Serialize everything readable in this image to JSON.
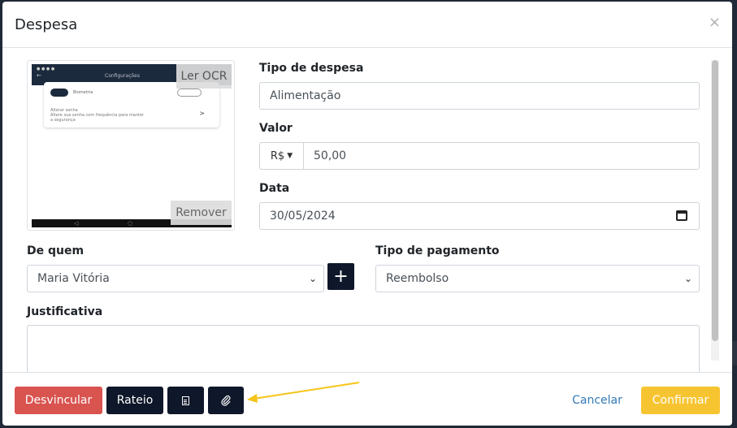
{
  "modal": {
    "title": "Despesa",
    "close_icon": "×"
  },
  "receipt": {
    "ocr_label": "Ler OCR",
    "remove_label": "Remover",
    "preview": {
      "screen_title": "Configurações",
      "row1_text": "Biometria",
      "row2_title": "Alterar senha",
      "row2_desc": "Altere sua senha com frequência para manter",
      "row2_desc2": "a segurança"
    }
  },
  "form": {
    "tipo_despesa": {
      "label": "Tipo de despesa",
      "value": "Alimentação"
    },
    "valor": {
      "label": "Valor",
      "currency": "R$",
      "value": "50,00"
    },
    "data": {
      "label": "Data",
      "value": "30/05/2024"
    },
    "de_quem": {
      "label": "De quem",
      "value": "Maria Vitória",
      "add_label": "+"
    },
    "tipo_pagamento": {
      "label": "Tipo de pagamento",
      "value": "Reembolso"
    },
    "justificativa": {
      "label": "Justificativa",
      "value": ""
    }
  },
  "footer": {
    "desvincular": "Desvincular",
    "rateio": "Rateio",
    "cancelar": "Cancelar",
    "confirmar": "Confirmar"
  },
  "icons": {
    "document": "document-icon",
    "paperclip": "paperclip-icon",
    "calendar": "calendar-icon",
    "plus": "plus-icon",
    "chevron": "chevron-down-icon"
  },
  "colors": {
    "danger": "#d9534f",
    "dark": "#0f172a",
    "warning": "#f7c431",
    "link": "#337ab7",
    "annotation_arrow": "#f5c518"
  }
}
